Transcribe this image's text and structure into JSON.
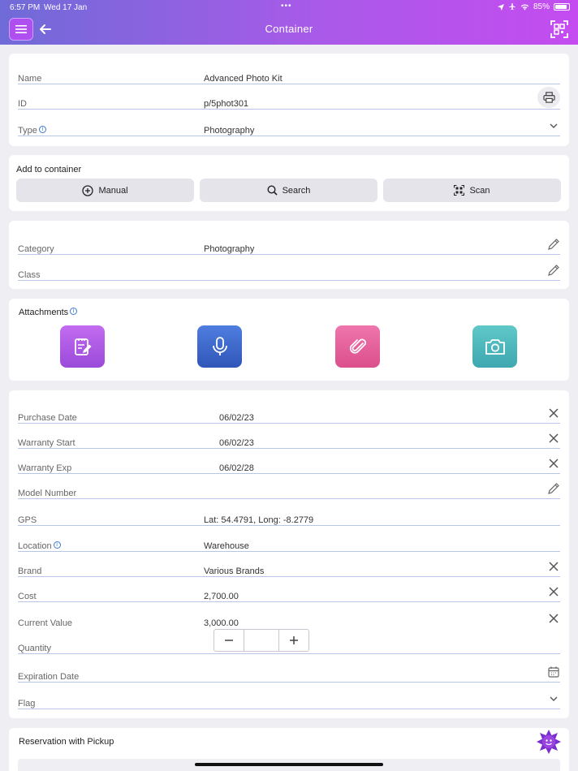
{
  "status_bar": {
    "time": "6:57 PM",
    "date": "Wed 17 Jan",
    "battery": "85%"
  },
  "header": {
    "title": "Container"
  },
  "item": {
    "name_label": "Name",
    "name_value": "Advanced Photo Kit",
    "id_label": "ID",
    "id_value": "p/5phot301",
    "type_label": "Type",
    "type_value": "Photography"
  },
  "add_container": {
    "title": "Add to container",
    "manual_label": "Manual",
    "search_label": "Search",
    "scan_label": "Scan"
  },
  "classification": {
    "category_label": "Category",
    "category_value": "Photography",
    "class_label": "Class",
    "class_value": ""
  },
  "attachments": {
    "title": "Attachments",
    "icons": [
      "notes-icon",
      "microphone-icon",
      "paperclip-icon",
      "camera-icon"
    ]
  },
  "details": {
    "purchase_date_label": "Purchase Date",
    "purchase_date_value": "06/02/23",
    "warranty_start_label": "Warranty Start",
    "warranty_start_value": "06/02/23",
    "warranty_exp_label": "Warranty Exp",
    "warranty_exp_value": "06/02/28",
    "model_number_label": "Model Number",
    "model_number_value": "",
    "gps_label": "GPS",
    "gps_value": "Lat: 54.4791, Long: -8.2779",
    "location_label": "Location",
    "location_value": "Warehouse",
    "brand_label": "Brand",
    "brand_value": "Various Brands",
    "cost_label": "Cost",
    "cost_value": "2,700.00",
    "current_value_label": "Current Value",
    "current_value_value": "3,000.00",
    "quantity_label": "Quantity",
    "quantity_value": "",
    "expiration_date_label": "Expiration Date",
    "expiration_date_value": "",
    "flag_label": "Flag",
    "flag_value": ""
  },
  "reservation": {
    "title": "Reservation with Pickup"
  },
  "colors": {
    "header_start": "#6f6bd8",
    "header_end": "#c44cf0",
    "notes": "#b05ae9",
    "microphone": "#3a63c8",
    "paperclip": "#e6609c",
    "camera": "#4db8bd"
  }
}
